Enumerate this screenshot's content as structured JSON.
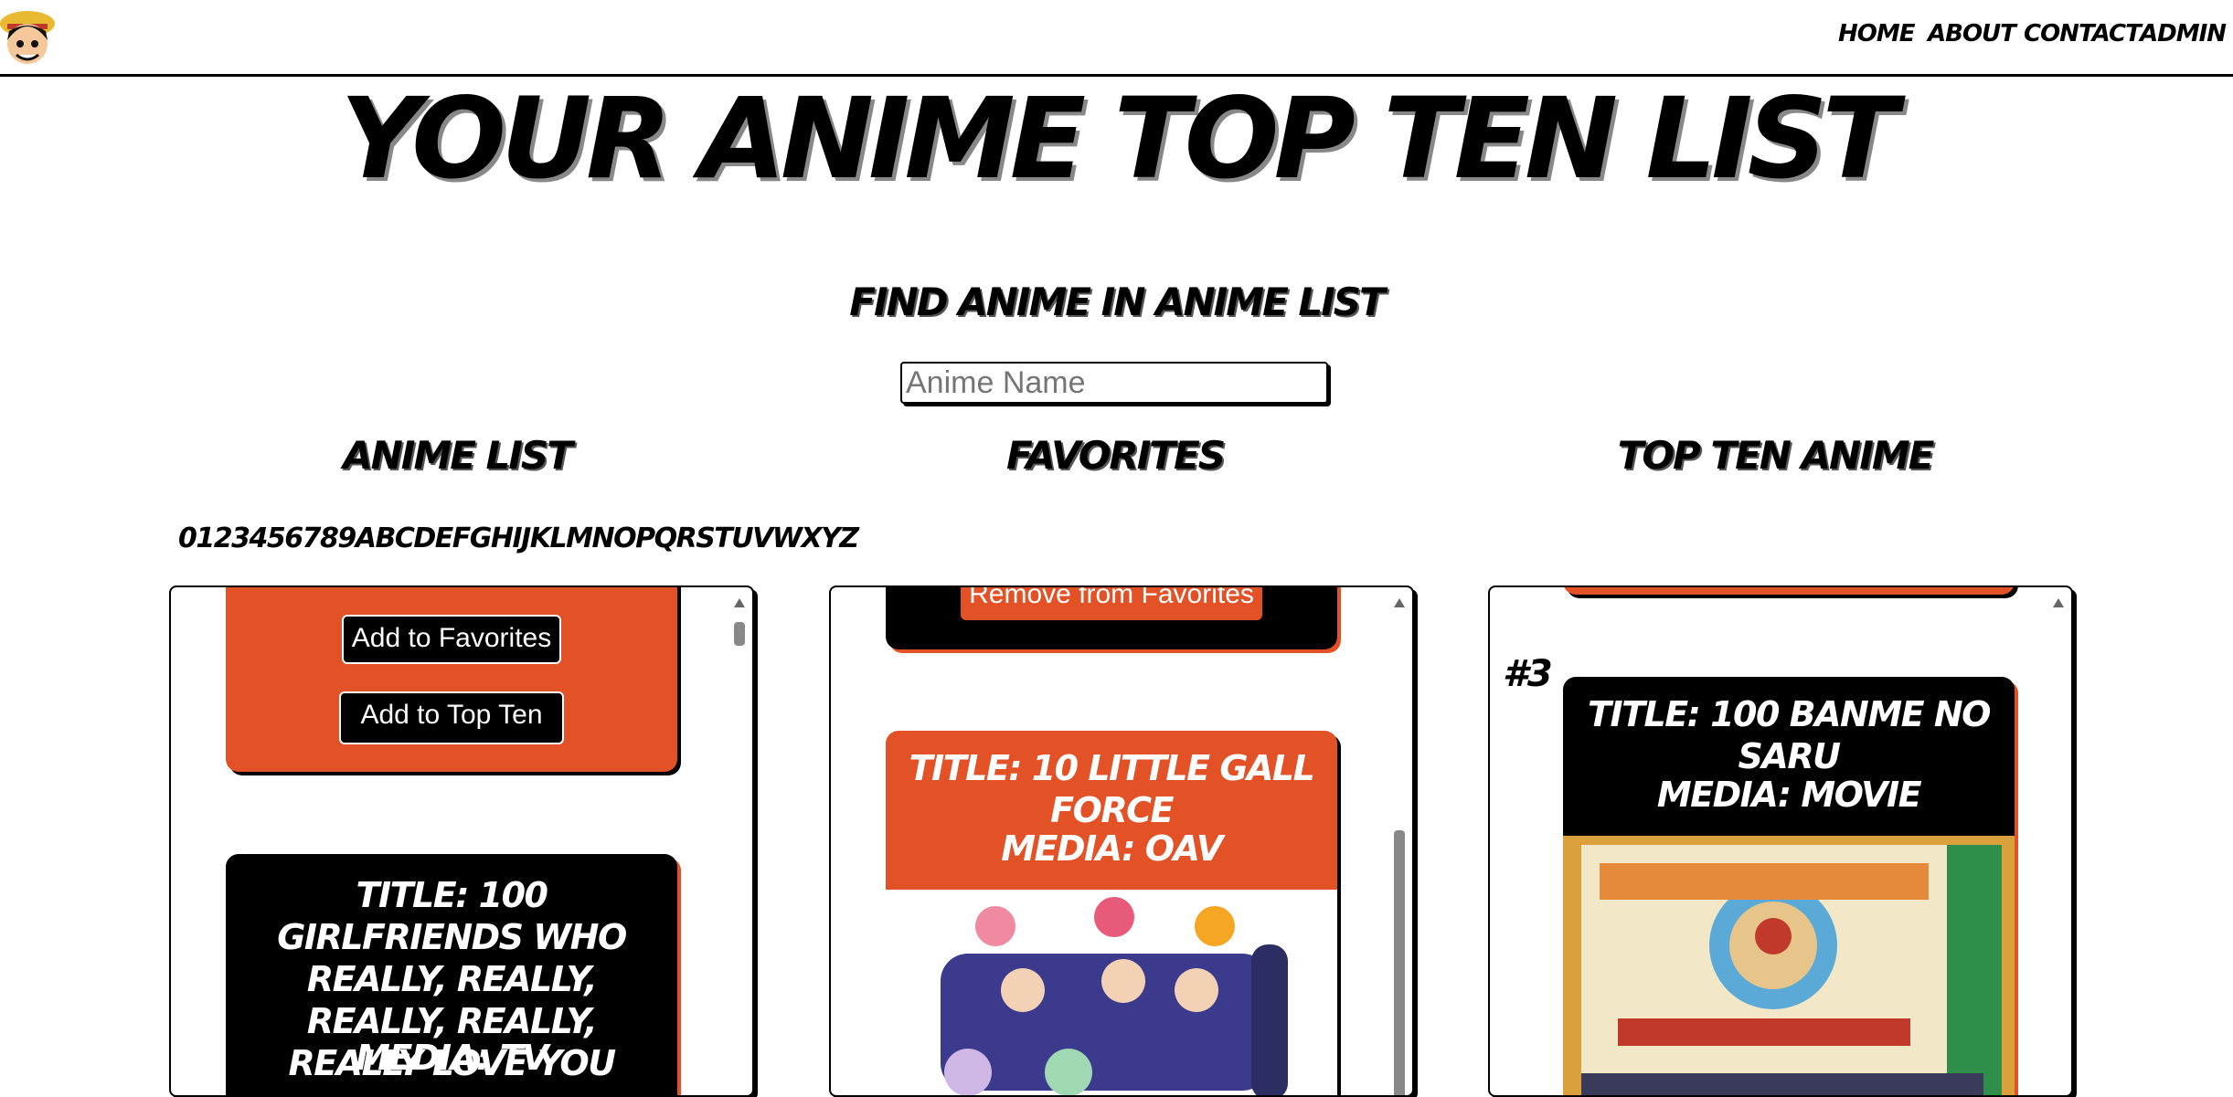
{
  "nav": {
    "links": [
      "Home",
      "About",
      "Contact",
      "Admin"
    ]
  },
  "page_title": "YOUR ANIME TOP TEN LIST",
  "search": {
    "title": "Find Anime in Anime List",
    "placeholder": "Anime Name"
  },
  "columns": {
    "anime_list": {
      "title": "Anime List",
      "alphabet": "0123456789ABCDEFGHIJKLMNOPQRSTUVWXYZ",
      "card1": {
        "add_favorites": "Add to Favorites",
        "add_top_ten": "Add to Top Ten"
      },
      "card2": {
        "title": "Title: 100 Girlfriends Who Really, Really, Really, Really, Really Love You",
        "media": "Media: TV"
      }
    },
    "favorites": {
      "title": "Favorites",
      "card1": {
        "remove": "Remove from Favorites"
      },
      "card2": {
        "title": "Title: 10 Little Gall Force",
        "media": "Media: OAV"
      }
    },
    "top_ten": {
      "title": "Top Ten Anime",
      "item": {
        "rank": "#3",
        "title": "Title: 100 Banme no Saru",
        "media": "Media: Movie"
      }
    }
  },
  "colors": {
    "accent": "#e25226",
    "black": "#000000"
  }
}
